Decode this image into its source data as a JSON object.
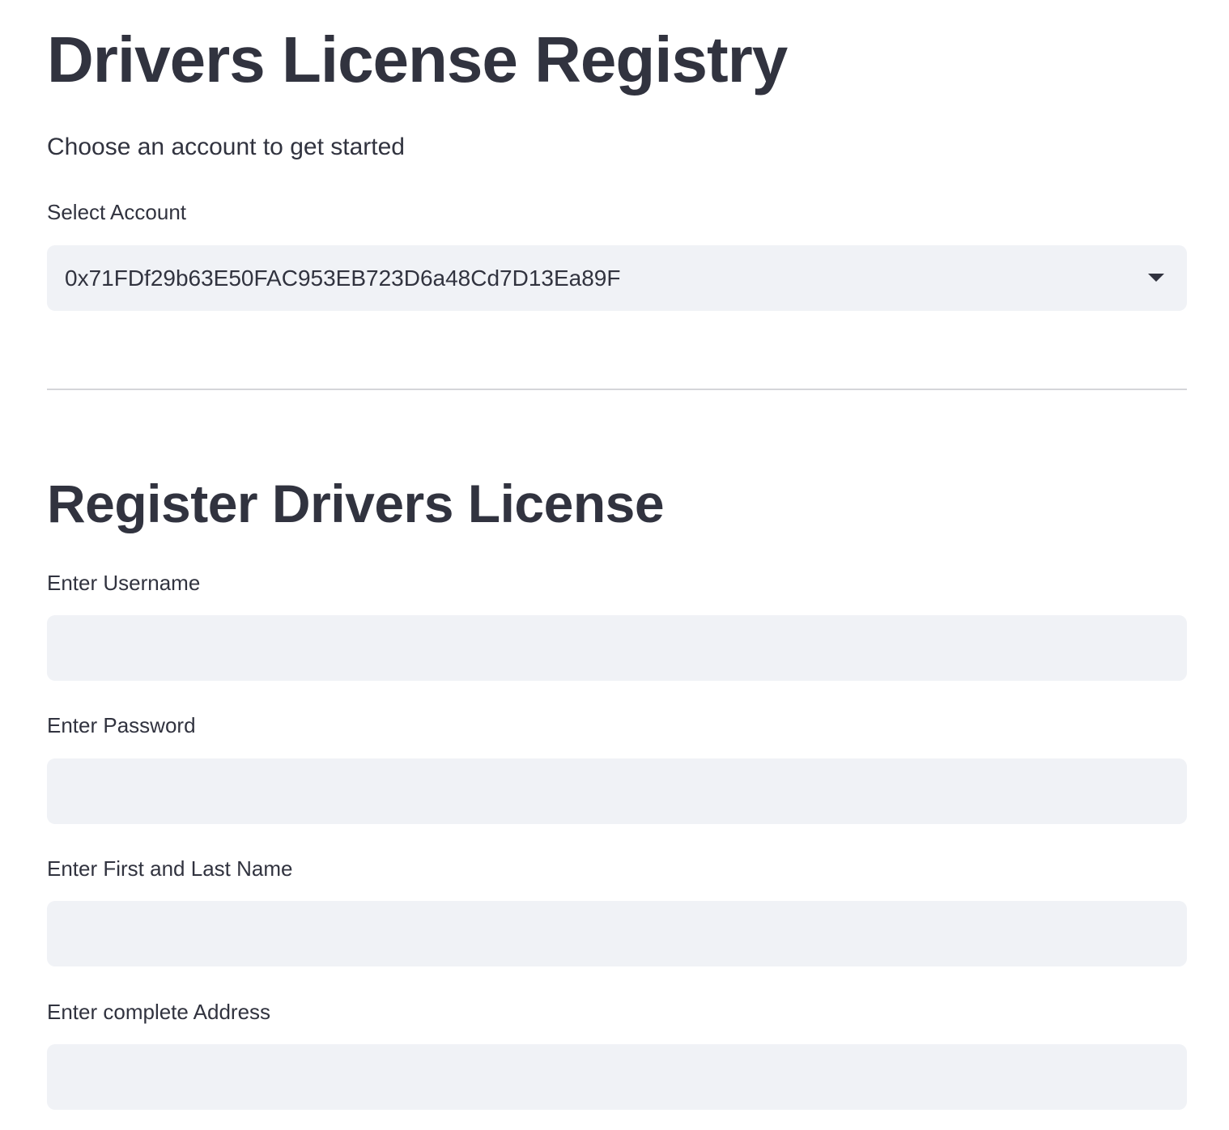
{
  "header": {
    "title": "Drivers License Registry",
    "subtitle": "Choose an account to get started"
  },
  "account_select": {
    "label": "Select Account",
    "selected_value": "0x71FDf29b63E50FAC953EB723D6a48Cd7D13Ea89F",
    "icon": "chevron-down-icon"
  },
  "register_section": {
    "title": "Register Drivers License",
    "fields": [
      {
        "label": "Enter Username",
        "value": "",
        "placeholder": ""
      },
      {
        "label": "Enter Password",
        "value": "",
        "placeholder": ""
      },
      {
        "label": "Enter First and Last Name",
        "value": "",
        "placeholder": ""
      },
      {
        "label": "Enter complete Address",
        "value": "",
        "placeholder": ""
      }
    ]
  },
  "colors": {
    "text": "#31333f",
    "input_background": "#f0f2f6",
    "divider": "#d5d6d9",
    "page_background": "#ffffff"
  }
}
